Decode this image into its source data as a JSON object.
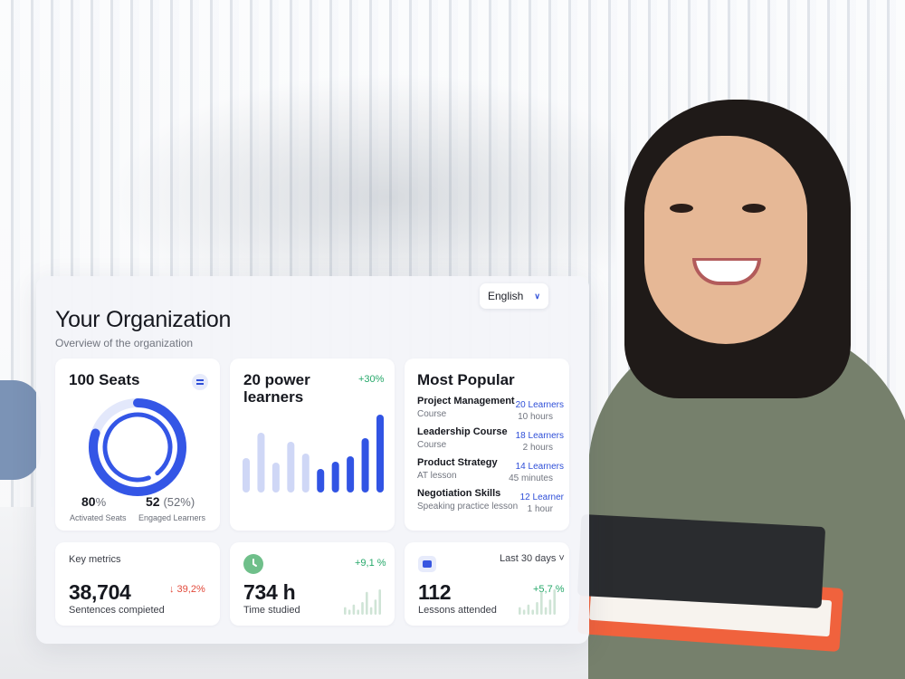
{
  "org": {
    "title": "Your Organization",
    "subtitle": "Overview of the organization",
    "language": "English"
  },
  "seats": {
    "title": "100 Seats",
    "activated_value": "80",
    "activated_unit": "%",
    "activated_label": "Activated Seats",
    "activated_fraction": 0.8,
    "engaged_value": "52",
    "engaged_pct": "(52%)",
    "engaged_label": "Engaged Learners",
    "engaged_fraction": 0.52,
    "colors": {
      "primary": "#3456e6",
      "track": "#e3e8fb"
    }
  },
  "power": {
    "title": "20 power learners",
    "change": "+30%",
    "bar_values": [
      38,
      66,
      33,
      56,
      43,
      26,
      34,
      40,
      60,
      86
    ],
    "bar_highlight_from": 5,
    "colors": {
      "light": "#cfd7f6",
      "dark": "#3154e4"
    }
  },
  "popular": {
    "title": "Most Popular",
    "items": [
      {
        "name": "Project Management",
        "type": "Course",
        "learners": "20 Learners",
        "duration": "10 hours"
      },
      {
        "name": "Leadership Course",
        "type": "Course",
        "learners": "18 Learners",
        "duration": "2 hours"
      },
      {
        "name": "Product Strategy",
        "type": "AT lesson",
        "learners": "14 Learners",
        "duration": "45 minutes"
      },
      {
        "name": "Negotiation Skills",
        "type": "Speaking practice lesson",
        "learners": "12 Learner",
        "duration": "1 hour"
      }
    ]
  },
  "metrics": {
    "key": {
      "label": "Key metrics",
      "value": "38,704",
      "caption": "Sentences compieted",
      "change": "↓ 39,2%"
    },
    "time": {
      "value": "734 h",
      "caption": "Time studied",
      "change": "+9,1 %",
      "icon": "clock-icon"
    },
    "lessons": {
      "value": "112",
      "caption": "Lessons attended",
      "change": "+5,7 %",
      "period": "Last 30 days ˅",
      "icon": "lesson-icon"
    },
    "spark_values": [
      3,
      2,
      4,
      2,
      5,
      9,
      3,
      6,
      10
    ]
  }
}
